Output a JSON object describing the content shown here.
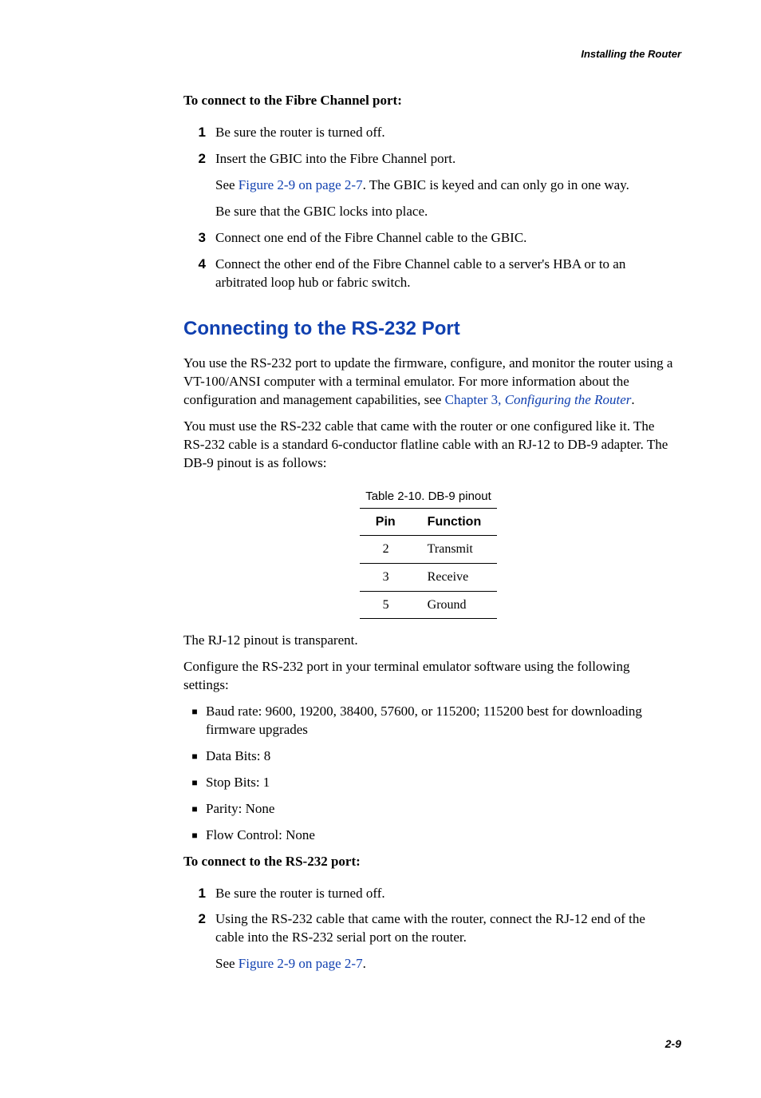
{
  "header": {
    "title": "Installing the Router"
  },
  "section1": {
    "intro": "To connect to the Fibre Channel port:",
    "steps": [
      {
        "num": "1",
        "text": "Be sure the router is turned off."
      },
      {
        "num": "2",
        "text": "Insert the GBIC into the Fibre Channel port.",
        "sub": [
          {
            "pre": "See ",
            "link": "Figure 2-9 on page 2-7",
            "post": ". The GBIC is keyed and can only go in one way."
          },
          {
            "plain": "Be sure that the GBIC locks into place."
          }
        ]
      },
      {
        "num": "3",
        "text": "Connect one end of the Fibre Channel cable to the GBIC."
      },
      {
        "num": "4",
        "text": "Connect the other end of the Fibre Channel cable to a server's HBA or to an arbitrated loop hub or fabric switch."
      }
    ]
  },
  "section2": {
    "heading": "Connecting to the RS-232 Port",
    "para1_pre": "You use the RS-232 port to update the firmware, configure, and monitor the router using a VT-100/ANSI computer with a terminal emulator. For more information about the configuration and management capabilities, see ",
    "para1_link1": "Chapter 3, ",
    "para1_link2": "Configuring the Router",
    "para1_post": ".",
    "para2": "You must use the RS-232 cable that came with the router or one configured like it. The RS-232 cable is a standard 6-conductor flatline cable with an RJ-12 to DB-9 adapter. The DB-9 pinout is as follows:",
    "table": {
      "caption": "Table 2-10. DB-9 pinout",
      "headers": {
        "c1": "Pin",
        "c2": "Function"
      },
      "rows": [
        {
          "pin": "2",
          "fn": "Transmit"
        },
        {
          "pin": "3",
          "fn": "Receive"
        },
        {
          "pin": "5",
          "fn": "Ground"
        }
      ]
    },
    "para3": "The RJ-12 pinout is transparent.",
    "para4": "Configure the RS-232 port in your terminal emulator software using the following settings:",
    "bullets": [
      "Baud rate: 9600, 19200, 38400, 57600, or 115200; 115200 best for downloading firmware upgrades",
      "Data Bits: 8",
      "Stop Bits: 1",
      "Parity: None",
      "Flow Control: None"
    ],
    "intro2": "To connect to the RS-232 port:",
    "steps2": [
      {
        "num": "1",
        "text": "Be sure the router is turned off."
      },
      {
        "num": "2",
        "text": "Using the RS-232 cable that came with the router, connect the RJ-12 end of the cable into the RS-232 serial port on the router.",
        "sub": [
          {
            "pre": "See ",
            "link": "Figure 2-9 on page 2-7",
            "post": "."
          }
        ]
      }
    ]
  },
  "footer": {
    "pagenum": "2-9"
  }
}
